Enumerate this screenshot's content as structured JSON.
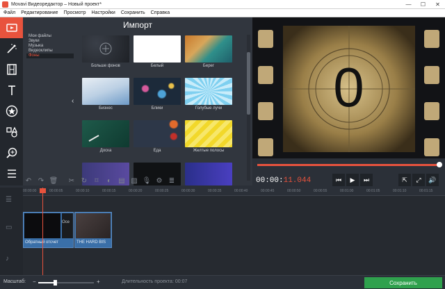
{
  "titlebar": {
    "title": "Movavi Видеоредактор – Новый проект*",
    "minimize": "—",
    "maximize": "☐",
    "close": "✕"
  },
  "menu": [
    {
      "label": "Файл"
    },
    {
      "label": "Редактирование"
    },
    {
      "label": "Просмотр"
    },
    {
      "label": "Настройки"
    },
    {
      "label": "Сохранить"
    },
    {
      "label": "Справка"
    }
  ],
  "left_toolbar": [
    {
      "name": "import-tool",
      "icon": "film-import-icon",
      "active": true
    },
    {
      "name": "filters-tool",
      "icon": "magic-wand-icon",
      "active": false
    },
    {
      "name": "transitions-tool",
      "icon": "filmstrip-icon",
      "active": false
    },
    {
      "name": "titles-tool",
      "icon": "text-icon",
      "active": false
    },
    {
      "name": "stickers-tool",
      "icon": "star-icon",
      "active": false
    },
    {
      "name": "shapes-tool",
      "icon": "shapes-icon",
      "active": false
    },
    {
      "name": "zoom-tool",
      "icon": "zoom-in-icon",
      "active": false
    },
    {
      "name": "more-tool",
      "icon": "list-icon",
      "active": false
    }
  ],
  "import": {
    "header": "Импорт",
    "categories": [
      {
        "label": "Мои файлы",
        "selected": false
      },
      {
        "label": "Звуки",
        "selected": false
      },
      {
        "label": "Музыка",
        "selected": false
      },
      {
        "label": "Видеоклипы",
        "selected": false
      },
      {
        "label": "Фоны",
        "selected": false
      }
    ],
    "collapse": "‹",
    "thumbnails": [
      {
        "label": "Больше фонов",
        "style": "pattern-dark"
      },
      {
        "label": "Белый",
        "style": "white"
      },
      {
        "label": "Берег",
        "style": "shore"
      },
      {
        "label": "Бизнес",
        "style": "business"
      },
      {
        "label": "Блики",
        "style": "bokeh"
      },
      {
        "label": "Голубые лучи",
        "style": "blue-rays"
      },
      {
        "label": "Доска",
        "style": "chalkboard"
      },
      {
        "label": "Еда",
        "style": "food"
      },
      {
        "label": "Желтые полосы",
        "style": "yellow-stripes"
      }
    ]
  },
  "preview": {
    "countdown": "0"
  },
  "player": {
    "time_prefix": "00:00:",
    "time_current": "11.044",
    "progress": 1.0,
    "buttons": {
      "prev": "⏮",
      "play": "▶",
      "next": "⏭",
      "export": "⇱",
      "fullscreen": "⤢",
      "volume": "🔊"
    }
  },
  "edit_toolbar": [
    "↶",
    "↷",
    "🗑",
    "✂",
    "↻",
    "⌑",
    "◐",
    "▤",
    "▨",
    "🎙",
    "⚙",
    "≣"
  ],
  "timeline": {
    "ruler": [
      "00:00:00",
      "00:00:05",
      "00:00:10",
      "00:00:15",
      "00:00:20",
      "00:00:25",
      "00:00:30",
      "00:00:35",
      "00:00:40",
      "00:00:45",
      "00:00:50",
      "00:00:55",
      "00:01:00",
      "00:01:05",
      "00:01:10",
      "00:01:15"
    ],
    "clips": [
      {
        "label": "Обратный отсчет",
        "overlay": "Осе"
      },
      {
        "label": "THE HARD BIS"
      }
    ],
    "track_icons": [
      "☰",
      "▭",
      "♪"
    ]
  },
  "status": {
    "zoom_label": "Масштаб:",
    "zoom_minus": "−",
    "zoom_plus": "+",
    "zoom_level": 0.3,
    "duration_label": "Длительность проекта: 00:07",
    "save_button": "Сохранить"
  },
  "colors": {
    "accent": "#e8533d",
    "save": "#2fa14d",
    "clip": "#3a6fa8"
  }
}
